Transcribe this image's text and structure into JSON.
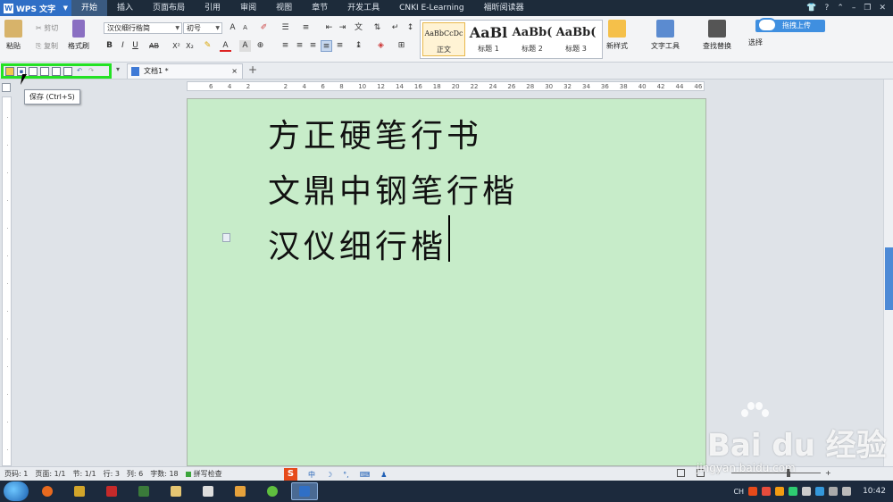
{
  "app": {
    "name": "WPS 文字"
  },
  "menu": {
    "tabs": [
      "开始",
      "插入",
      "页面布局",
      "引用",
      "审阅",
      "视图",
      "章节",
      "开发工具",
      "CNKI E-Learning",
      "福昕阅读器"
    ],
    "active": "开始"
  },
  "ribbon": {
    "paste": "粘贴",
    "cut": "剪切",
    "copy": "复制",
    "format_painter": "格式刷",
    "font_name": "汉仪细行楷简",
    "font_size": "初号",
    "styles": [
      {
        "preview": "AaBbCcDc",
        "name": "正文"
      },
      {
        "preview": "AaBl",
        "name": "标题 1"
      },
      {
        "preview": "AaBb(",
        "name": "标题 2"
      },
      {
        "preview": "AaBb(",
        "name": "标题 3"
      }
    ],
    "new_style": "新样式",
    "text_tools": "文字工具",
    "find_replace": "查找替换",
    "select": "选择",
    "upload": "拖拽上传"
  },
  "quick_access": {
    "tooltip": "保存 (Ctrl+S)"
  },
  "doc_tab": {
    "title": "文档1 *",
    "close": "×",
    "new": "+"
  },
  "ruler": {
    "marks": [
      "6",
      "4",
      "2",
      "",
      "2",
      "4",
      "6",
      "8",
      "10",
      "12",
      "14",
      "16",
      "18",
      "20",
      "22",
      "24",
      "26",
      "28",
      "30",
      "32",
      "34",
      "36",
      "38",
      "40",
      "42",
      "44",
      "46"
    ]
  },
  "document": {
    "lines": [
      "方正硬笔行书",
      "文鼎中钢笔行楷",
      "汉仪细行楷"
    ]
  },
  "status": {
    "page_num": "页码: 1",
    "page": "页面: 1/1",
    "section": "节: 1/1",
    "row": "行: 3",
    "col": "列: 6",
    "words": "字数: 18",
    "spell": "拼写检查",
    "ime_s": "S",
    "ime_zh": "中"
  },
  "taskbar": {
    "clock": "10:42",
    "lang": "CH"
  },
  "watermark": {
    "text": "Bai du 经验",
    "url": "jingyan.baidu.com"
  }
}
